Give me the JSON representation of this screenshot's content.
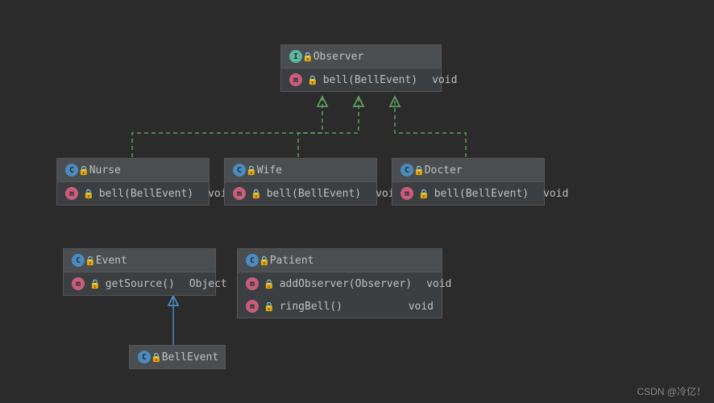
{
  "diagram": {
    "observer": {
      "name": "Observer",
      "method": "bell(BellEvent)",
      "ret": "void"
    },
    "nurse": {
      "name": "Nurse",
      "method": "bell(BellEvent)",
      "ret": "void"
    },
    "wife": {
      "name": "Wife",
      "method": "bell(BellEvent)",
      "ret": "void"
    },
    "docter": {
      "name": "Docter",
      "method": "bell(BellEvent)",
      "ret": "void"
    },
    "event": {
      "name": "Event",
      "method": "getSource()",
      "ret": "Object"
    },
    "bellevent": {
      "name": "BellEvent"
    },
    "patient": {
      "name": "Patient",
      "m1": "addObserver(Observer)",
      "r1": "void",
      "m2": "ringBell()",
      "r2": "void"
    }
  },
  "watermark": "CSDN @冷亿！"
}
